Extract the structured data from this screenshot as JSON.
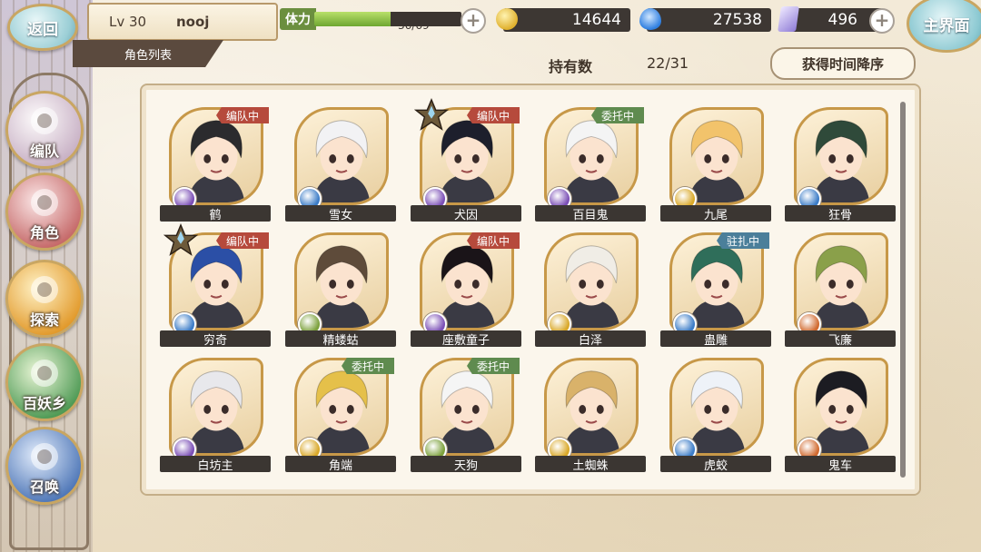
{
  "header": {
    "back_label": "返回",
    "level": "Lv 30",
    "player_name": "nooj",
    "list_tab": "角色列表",
    "stamina_label": "体力",
    "stamina_value": "36/69",
    "stamina_fraction": 0.52,
    "gold": "14644",
    "soul": "27538",
    "gem": "496",
    "home_label": "主界面",
    "colors": {
      "stamina": "#6b8f3f",
      "gold": "#e0b12e",
      "soul": "#2f7fe0",
      "gem": "#8e7bd6"
    }
  },
  "summary": {
    "owned_label": "持有数",
    "owned_value": "22/31",
    "sort_label": "获得时间降序"
  },
  "nav": {
    "items": [
      {
        "label": "编队",
        "icon": "formation-icon"
      },
      {
        "label": "角色",
        "icon": "character-icon"
      },
      {
        "label": "探索",
        "icon": "explore-icon"
      },
      {
        "label": "百妖乡",
        "icon": "village-icon"
      },
      {
        "label": "召唤",
        "icon": "summon-icon"
      }
    ]
  },
  "status_colors": {
    "编队中": "#b64a3c",
    "委托中": "#5f8b4f",
    "驻扎中": "#4b7f9a"
  },
  "element_colors": {
    "purple": "#7b4fb6",
    "blue": "#3b7cc7",
    "gold": "#d9a828",
    "green": "#7ca13c",
    "red": "#d16a2f"
  },
  "characters": [
    {
      "name": "鹤",
      "status": "编队中",
      "element": "purple",
      "hair": "#2b2b2e",
      "star": false
    },
    {
      "name": "雪女",
      "status": "",
      "element": "blue",
      "hair": "#f2f2f4",
      "star": false
    },
    {
      "name": "犬因",
      "status": "编队中",
      "element": "purple",
      "hair": "#1d1f2c",
      "star": true
    },
    {
      "name": "百目鬼",
      "status": "委托中",
      "element": "purple",
      "hair": "#f4f4f4",
      "star": false
    },
    {
      "name": "九尾",
      "status": "",
      "element": "gold",
      "hair": "#f2c36b",
      "star": false
    },
    {
      "name": "狂骨",
      "status": "",
      "element": "blue",
      "hair": "#2f4a3a",
      "star": false
    },
    {
      "name": "穷奇",
      "status": "编队中",
      "element": "blue",
      "hair": "#2b4fa6",
      "star": true
    },
    {
      "name": "精蝼蛄",
      "status": "",
      "element": "green",
      "hair": "#5e4b3a",
      "star": false
    },
    {
      "name": "座敷童子",
      "status": "编队中",
      "element": "purple",
      "hair": "#1a1418",
      "star": false
    },
    {
      "name": "白泽",
      "status": "",
      "element": "gold",
      "hair": "#f0ede6",
      "star": false
    },
    {
      "name": "蛊雕",
      "status": "驻扎中",
      "element": "blue",
      "hair": "#2f6e5a",
      "star": false
    },
    {
      "name": "飞廉",
      "status": "",
      "element": "red",
      "hair": "#8aa04a",
      "star": false
    },
    {
      "name": "白坊主",
      "status": "",
      "element": "purple",
      "hair": "#e8e8ec",
      "star": false
    },
    {
      "name": "角端",
      "status": "委托中",
      "element": "gold",
      "hair": "#e5c04a",
      "star": false
    },
    {
      "name": "天狗",
      "status": "委托中",
      "element": "green",
      "hair": "#f5f5f5",
      "star": false
    },
    {
      "name": "土蜘蛛",
      "status": "",
      "element": "gold",
      "hair": "#d9b26a",
      "star": false
    },
    {
      "name": "虎蛟",
      "status": "",
      "element": "blue",
      "hair": "#eef2f8",
      "star": false
    },
    {
      "name": "鬼车",
      "status": "",
      "element": "red",
      "hair": "#1c1c22",
      "star": false
    }
  ]
}
